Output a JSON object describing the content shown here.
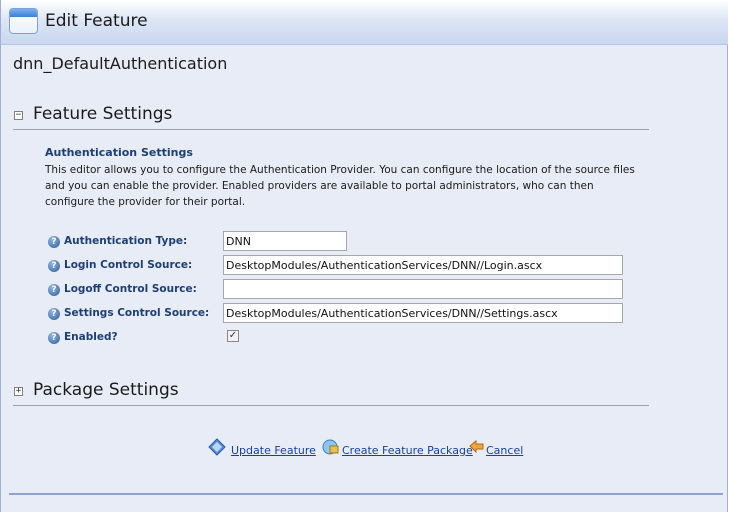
{
  "window": {
    "title": "Edit Feature",
    "module_name": "dnn_DefaultAuthentication"
  },
  "sections": {
    "feature_settings": {
      "title": "Feature Settings",
      "toggle": "⊟",
      "expanded": true
    },
    "package_settings": {
      "title": "Package Settings",
      "toggle": "⊞",
      "expanded": false
    }
  },
  "auth": {
    "heading": "Authentication Settings",
    "description": "This editor allows you to configure the Authentication Provider. You can configure the location of the source files and you can enable the provider. Enabled providers are available to portal administrators, who can then configure the provider for their portal."
  },
  "fields": {
    "auth_type": {
      "label": "Authentication Type:",
      "value": "DNN"
    },
    "login_source": {
      "label": "Login Control Source:",
      "value": "DesktopModules/AuthenticationServices/DNN//Login.ascx"
    },
    "logoff_source": {
      "label": "Logoff Control Source:",
      "value": ""
    },
    "settings_source": {
      "label": "Settings Control Source:",
      "value": "DesktopModules/AuthenticationServices/DNN//Settings.ascx"
    },
    "enabled": {
      "label": "Enabled?",
      "checked": true
    }
  },
  "actions": {
    "update": "Update Feature",
    "create_package": "Create Feature Package",
    "cancel": "Cancel"
  },
  "colors": {
    "background": "#e7ecf6",
    "label_blue": "#1c3f77",
    "link_blue": "#1c3f98"
  },
  "icons": {
    "title": "window-icon",
    "help": "help-icon",
    "update": "update-diamond-icon",
    "package": "package-icon",
    "cancel": "cancel-arrow-icon"
  }
}
